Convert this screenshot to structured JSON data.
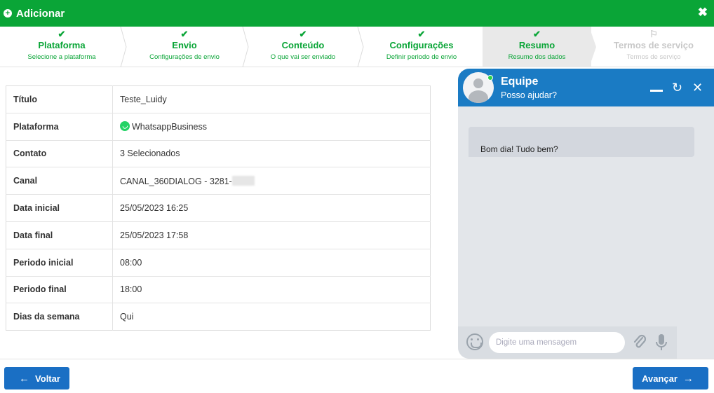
{
  "modal": {
    "title": "Adicionar",
    "plus_icon": "plus-circle-icon",
    "close_icon": "close-x-icon"
  },
  "steps": [
    {
      "name": "Plataforma",
      "sub": "Selecione a plataforma",
      "state": "done"
    },
    {
      "name": "Envio",
      "sub": "Configurações de envio",
      "state": "done"
    },
    {
      "name": "Conteúdo",
      "sub": "O que vai ser enviado",
      "state": "done"
    },
    {
      "name": "Configurações",
      "sub": "Definir periodo de envio",
      "state": "done"
    },
    {
      "name": "Resumo",
      "sub": "Resumo dos dados",
      "state": "active"
    },
    {
      "name": "Termos de serviço",
      "sub": "Termos de serviço",
      "state": "disabled"
    }
  ],
  "summary": [
    {
      "label": "Título",
      "value": "Teste_Luidy"
    },
    {
      "label": "Plataforma",
      "value": "WhatsappBusiness"
    },
    {
      "label": "Contato",
      "value": "3 Selecionados"
    },
    {
      "label": "Canal",
      "value": "CANAL_360DIALOG - 3281-"
    },
    {
      "label": "Data inicial",
      "value": "25/05/2023 16:25"
    },
    {
      "label": "Data final",
      "value": "25/05/2023 17:58"
    },
    {
      "label": "Periodo inicial",
      "value": "08:00"
    },
    {
      "label": "Periodo final",
      "value": "18:00"
    },
    {
      "label": "Dias da semana",
      "value": "Qui"
    }
  ],
  "footer": {
    "back_label": "Voltar",
    "next_label": "Avançar"
  },
  "chat": {
    "title": "Equipe",
    "subtitle": "Posso ajudar?",
    "message": "Bom dia! Tudo bem?",
    "input_placeholder": "Digite uma mensagem"
  },
  "colors": {
    "green": "#0aa537",
    "blue": "#1a6fc4",
    "chat_header": "#1a7bc4"
  }
}
